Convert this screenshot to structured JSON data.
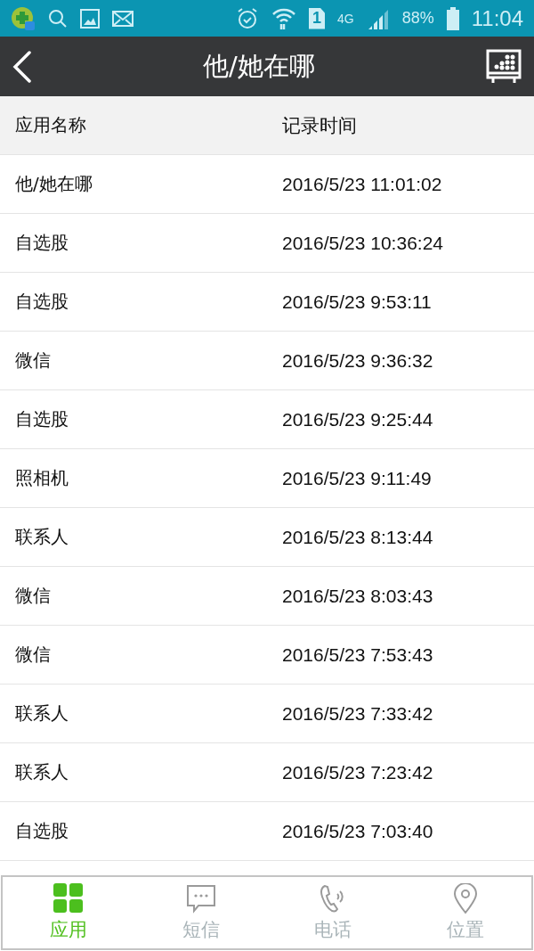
{
  "status_bar": {
    "sim": "1",
    "network": "4G",
    "battery": "88%",
    "time": "11:04"
  },
  "header": {
    "title": "他/她在哪"
  },
  "table": {
    "columns": [
      "应用名称",
      "记录时间"
    ],
    "rows": [
      [
        "他/她在哪",
        "2016/5/23 11:01:02"
      ],
      [
        "自选股",
        "2016/5/23 10:36:24"
      ],
      [
        "自选股",
        "2016/5/23 9:53:11"
      ],
      [
        "微信",
        "2016/5/23 9:36:32"
      ],
      [
        "自选股",
        "2016/5/23 9:25:44"
      ],
      [
        "照相机",
        "2016/5/23 9:11:49"
      ],
      [
        "联系人",
        "2016/5/23 8:13:44"
      ],
      [
        "微信",
        "2016/5/23 8:03:43"
      ],
      [
        "微信",
        "2016/5/23 7:53:43"
      ],
      [
        "联系人",
        "2016/5/23 7:33:42"
      ],
      [
        "联系人",
        "2016/5/23 7:23:42"
      ],
      [
        "自选股",
        "2016/5/23 7:03:40"
      ]
    ]
  },
  "tabs": [
    {
      "kind": "apps",
      "label": "应用",
      "selected": true
    },
    {
      "kind": "message",
      "label": "短信",
      "selected": false
    },
    {
      "kind": "phone",
      "label": "电话",
      "selected": false
    },
    {
      "kind": "location",
      "label": "位置",
      "selected": false
    }
  ]
}
